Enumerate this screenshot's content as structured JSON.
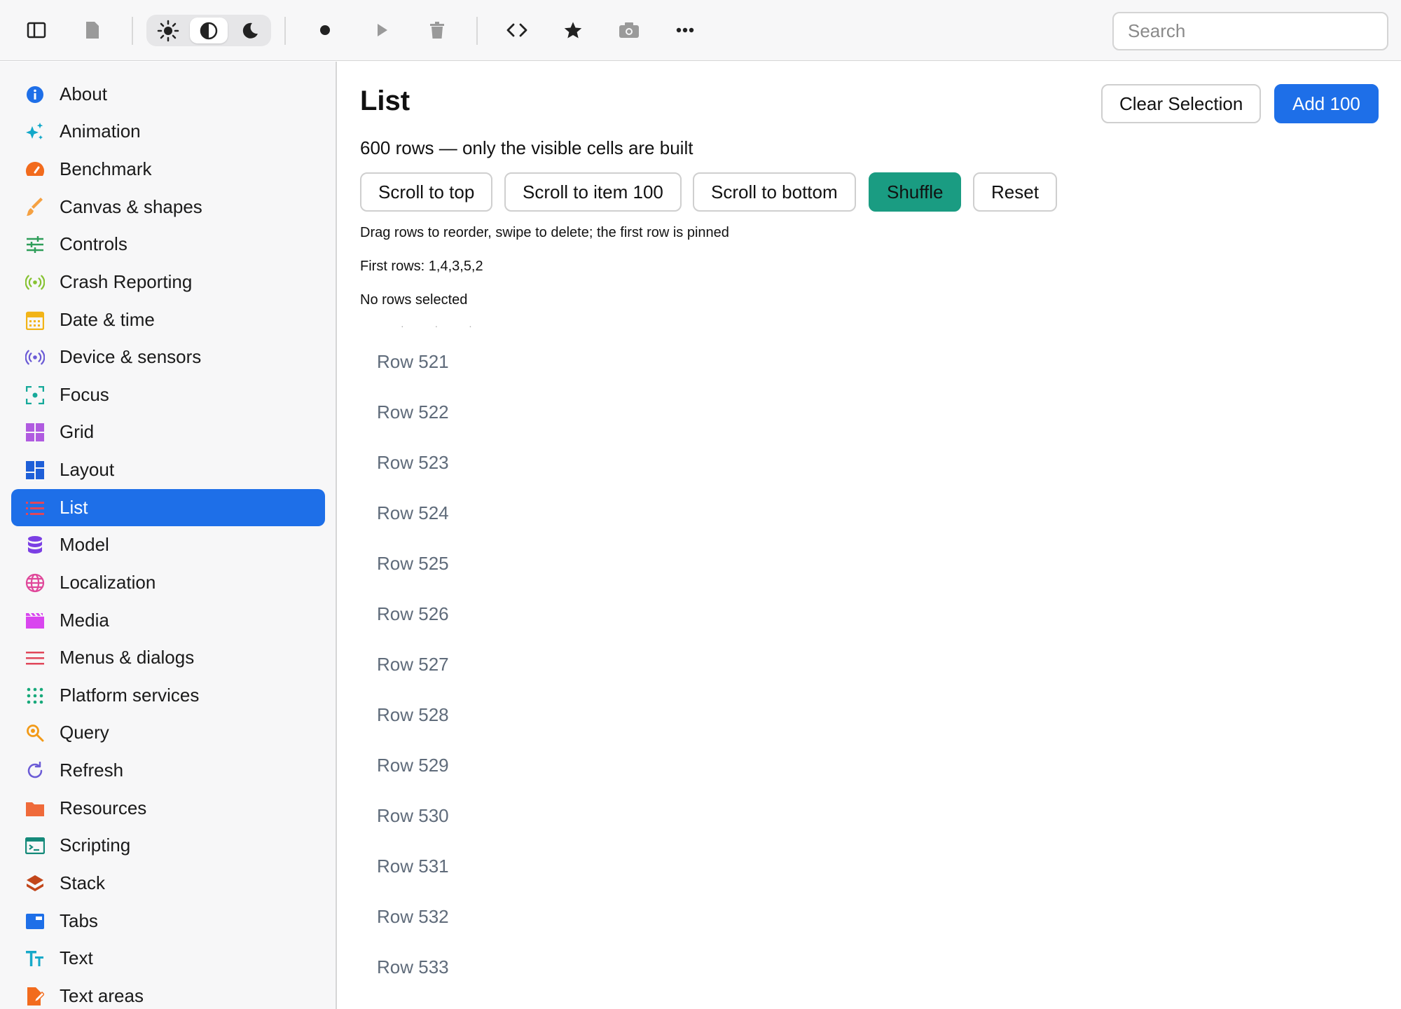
{
  "toolbar": {
    "search_placeholder": "Search",
    "icons": [
      "sidebar-toggle-icon",
      "document-icon",
      "sun-icon",
      "contrast-icon",
      "moon-icon",
      "record-icon",
      "play-icon",
      "trash-icon",
      "code-icon",
      "star-icon",
      "camera-icon",
      "more-icon"
    ],
    "theme_selected": "contrast"
  },
  "sidebar": {
    "items": [
      {
        "label": "About",
        "icon": "info-icon",
        "color": "#1e6fe8"
      },
      {
        "label": "Animation",
        "icon": "sparkles-icon",
        "color": "#12a8c9"
      },
      {
        "label": "Benchmark",
        "icon": "speedometer-icon",
        "color": "#f26b1d"
      },
      {
        "label": "Canvas & shapes",
        "icon": "paintbrush-icon",
        "color": "#f5a142"
      },
      {
        "label": "Controls",
        "icon": "sliders-icon",
        "color": "#2f9e5a"
      },
      {
        "label": "Crash Reporting",
        "icon": "broadcast-icon",
        "color": "#86c232"
      },
      {
        "label": "Date & time",
        "icon": "calendar-icon",
        "color": "#f2b418"
      },
      {
        "label": "Device & sensors",
        "icon": "sensor-icon",
        "color": "#6b5bd6"
      },
      {
        "label": "Focus",
        "icon": "focus-icon",
        "color": "#17a99a"
      },
      {
        "label": "Grid",
        "icon": "grid-icon",
        "color": "#b05be0"
      },
      {
        "label": "Layout",
        "icon": "layout-icon",
        "color": "#1e5fd8"
      },
      {
        "label": "List",
        "icon": "list-icon",
        "color": "#e0475a"
      },
      {
        "label": "Model",
        "icon": "database-icon",
        "color": "#7b3fe4"
      },
      {
        "label": "Localization",
        "icon": "globe-icon",
        "color": "#e0479a"
      },
      {
        "label": "Media",
        "icon": "clapperboard-icon",
        "color": "#d946ef"
      },
      {
        "label": "Menus & dialogs",
        "icon": "menu-icon",
        "color": "#e0475a"
      },
      {
        "label": "Platform services",
        "icon": "dots-grid-icon",
        "color": "#17a97a"
      },
      {
        "label": "Query",
        "icon": "magnifier-icon",
        "color": "#f29a18"
      },
      {
        "label": "Refresh",
        "icon": "refresh-icon",
        "color": "#6b5bd6"
      },
      {
        "label": "Resources",
        "icon": "folder-icon",
        "color": "#ef6a3a"
      },
      {
        "label": "Scripting",
        "icon": "terminal-icon",
        "color": "#158a7a"
      },
      {
        "label": "Stack",
        "icon": "layers-icon",
        "color": "#c2461a"
      },
      {
        "label": "Tabs",
        "icon": "tabs-icon",
        "color": "#1e6fe8"
      },
      {
        "label": "Text",
        "icon": "text-icon",
        "color": "#17a9c9"
      },
      {
        "label": "Text areas",
        "icon": "document-edit-icon",
        "color": "#f26b1d"
      }
    ],
    "active": "List"
  },
  "main": {
    "title": "List",
    "clear_selection_label": "Clear Selection",
    "add_label": "Add 100",
    "subtitle": "600 rows — only the visible cells are built",
    "actions": [
      "Scroll to top",
      "Scroll to item 100",
      "Scroll to bottom",
      "Shuffle",
      "Reset"
    ],
    "hint": "Drag rows to reorder, swipe to delete; the first row is pinned",
    "first_rows": "First rows: 1,4,3,5,2",
    "selection_status": "No rows selected",
    "rows": [
      "Row 521",
      "Row 522",
      "Row 523",
      "Row 524",
      "Row 525",
      "Row 526",
      "Row 527",
      "Row 528",
      "Row 529",
      "Row 530",
      "Row 531",
      "Row 532",
      "Row 533"
    ]
  },
  "colors": {
    "accent": "#1e6fe8",
    "shuffle": "#1a9c82",
    "row_text": "#5f6b7a"
  }
}
